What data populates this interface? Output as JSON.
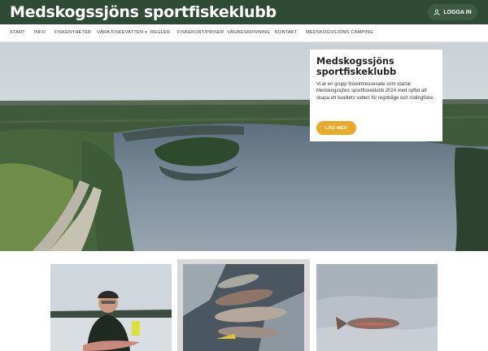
{
  "header": {
    "site_title": "Medskogssjöns sportfiskeklubb",
    "login_label": "LOGGA IN",
    "login_icon": "user-icon",
    "background_color": "#2f4a35"
  },
  "nav": {
    "items": [
      {
        "label": "START"
      },
      {
        "label": "INFO"
      },
      {
        "label": "FISKENYHETER"
      },
      {
        "label": "VÅRA FISKEVATTEN",
        "has_dropdown": true
      },
      {
        "label": "REGLER"
      },
      {
        "label": "FISKEKORT/PRISER"
      },
      {
        "label": "VÄGBESKRIVNING"
      },
      {
        "label": "KONTAKT"
      },
      {
        "label": "MEDSKOGSSJÖNS CAMPING"
      }
    ],
    "dropdown_caret": "▾"
  },
  "hero": {
    "title": "Medskogssjöns sportfiskeklubb",
    "text": "Vi är en grupp fiskeintresserade som startat Medskogssjöns sportfiskeklubb 2024 med syftet att skapa ett kvalitets vatten för regnbåge och rödingfiske.",
    "button_label": "LÄS MER",
    "accent_color": "#e9a929"
  },
  "gallery": {
    "photos": [
      {
        "name": "angler-with-fish"
      },
      {
        "name": "fish-on-ice"
      },
      {
        "name": "single-fish-on-snow"
      }
    ]
  }
}
